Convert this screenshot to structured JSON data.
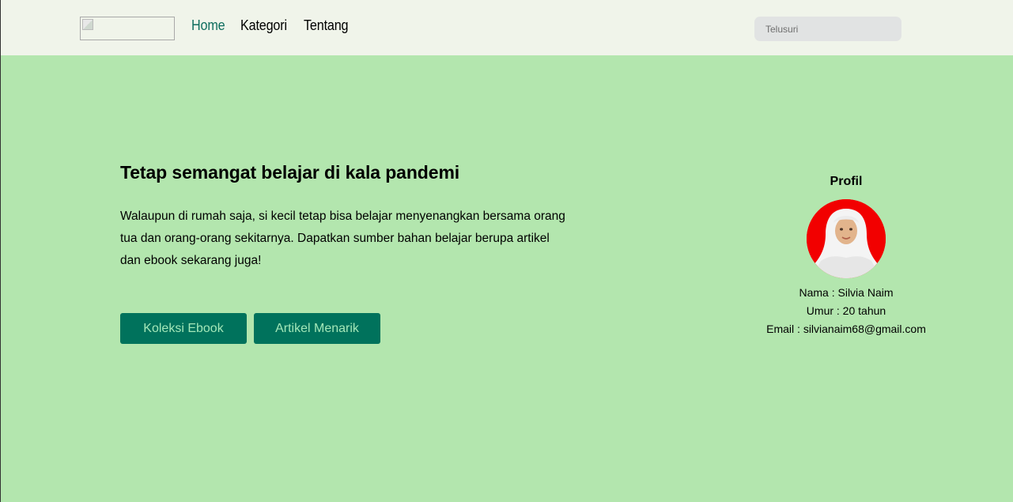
{
  "nav": {
    "logo_alt": "",
    "links": [
      "Home",
      "Kategori",
      "Tentang"
    ],
    "search_placeholder": "Telusuri"
  },
  "hero": {
    "title": "Tetap semangat belajar di kala pandemi",
    "description": "Walaupun di rumah saja, si kecil tetap bisa belajar menyenangkan bersama orang tua dan orang-orang sekitarnya. Dapatkan sumber bahan belajar berupa artikel dan ebook sekarang juga!",
    "buttons": [
      "Koleksi Ebook",
      "Artikel Menarik"
    ]
  },
  "profile": {
    "heading": "Profil",
    "name_line": "Nama : Silvia Naim",
    "age_line": "Umur : 20 tahun",
    "email_line": "Email : silvianaim68@gmail.com"
  },
  "colors": {
    "page_background": "#b3e6ae",
    "navbar_background": "#f0f4ea",
    "nav_active": "#0f6e5e",
    "button_background": "#00725c",
    "button_text": "#a3e7b8",
    "avatar_background": "#f20000"
  }
}
